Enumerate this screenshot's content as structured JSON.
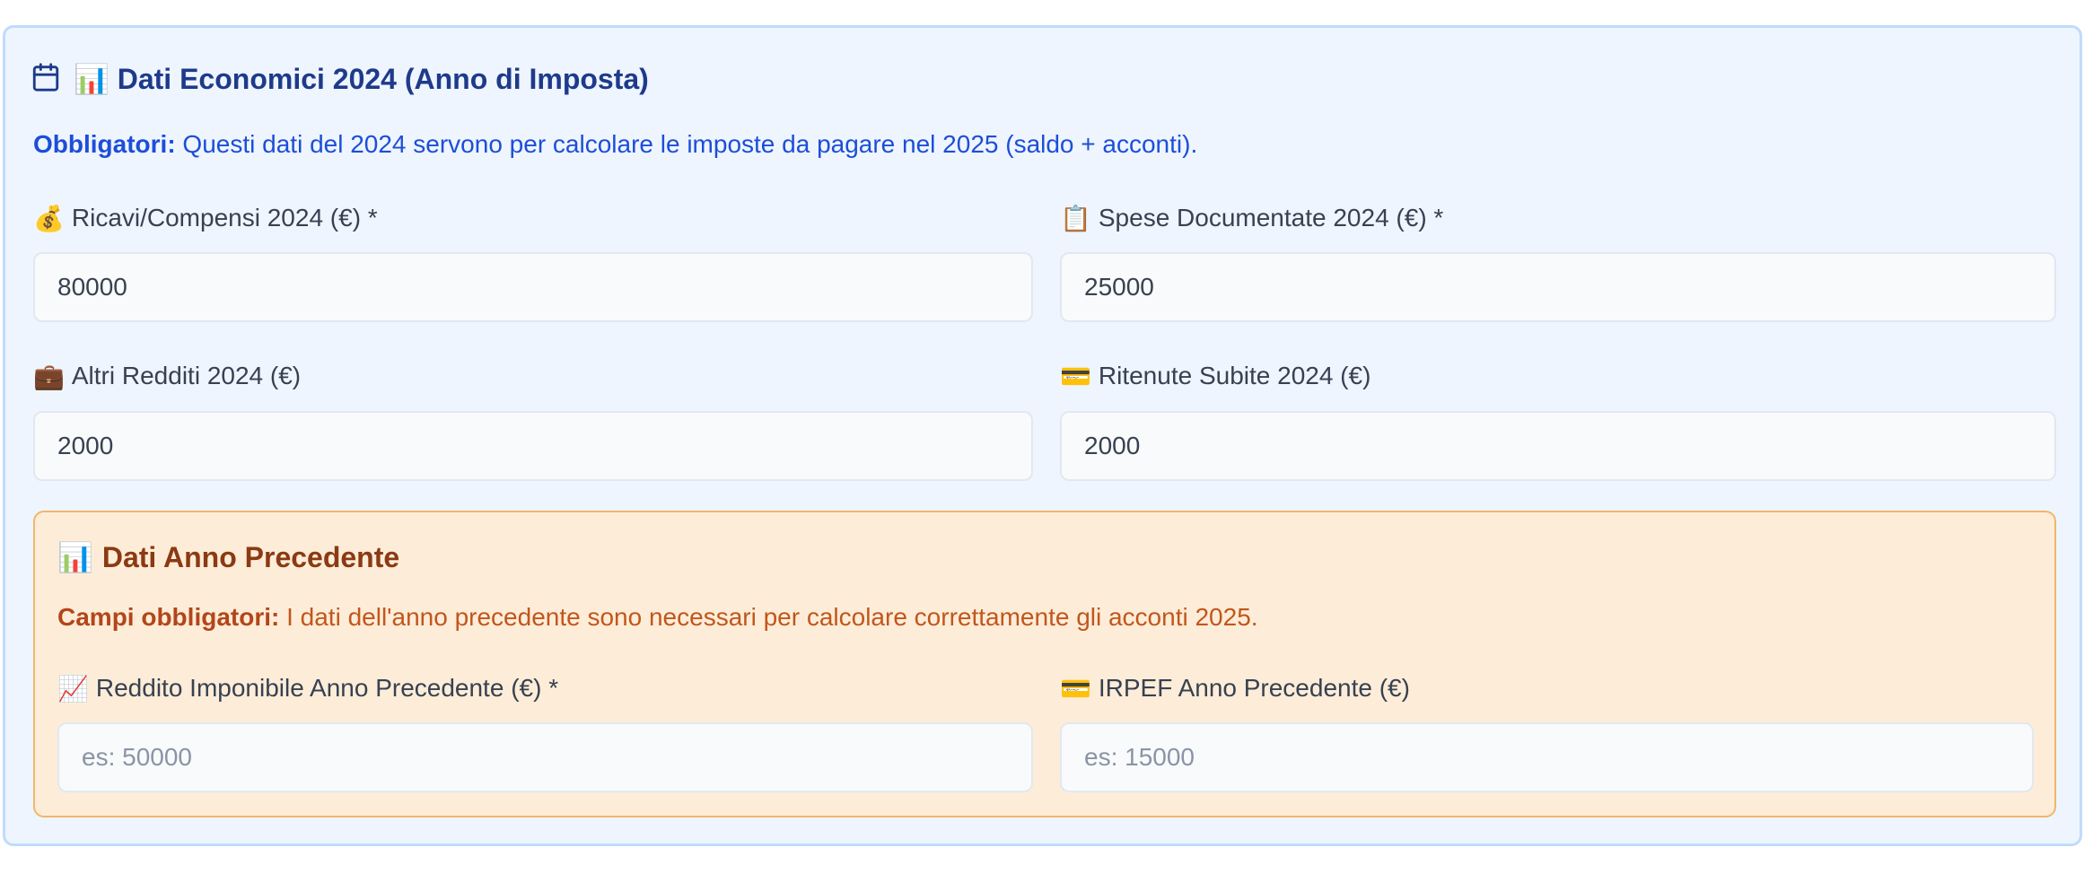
{
  "section": {
    "title": "📊 Dati Economici 2024 (Anno di Imposta)",
    "notice_bold": "Obbligatori:",
    "notice_text": " Questi dati del 2024 servono per calcolare le imposte da pagare nel 2025 (saldo + acconti)."
  },
  "fields": {
    "ricavi": {
      "label": "Ricavi/Compensi 2024 (€) *",
      "value": "80000",
      "icon": "money-bag-icon"
    },
    "spese": {
      "label": "Spese Documentate 2024 (€) *",
      "value": "25000",
      "icon": "clipboard-icon"
    },
    "altri": {
      "label": "Altri Redditi 2024 (€)",
      "value": "2000",
      "icon": "briefcase-icon"
    },
    "ritenute": {
      "label": "Ritenute Subite 2024 (€)",
      "value": "2000",
      "icon": "credit-card-icon"
    }
  },
  "previous": {
    "title": "Dati Anno Precedente",
    "notice_bold": "Campi obbligatori:",
    "notice_text": " I dati dell'anno precedente sono necessari per calcolare correttamente gli acconti 2025.",
    "reddito": {
      "label": "Reddito Imponibile Anno Precedente (€) *",
      "placeholder": "es: 50000",
      "value": "",
      "icon": "chart-increasing-icon"
    },
    "irpef": {
      "label": "IRPEF Anno Precedente (€)",
      "placeholder": "es: 15000",
      "value": "",
      "icon": "credit-card-icon"
    }
  },
  "colors": {
    "card_bg": "#eef5fe",
    "card_border": "#bfdbfe",
    "title": "#1e3a8a",
    "notice": "#1d4ed8",
    "prev_bg": "#fdedd8",
    "prev_border": "#f0b76a",
    "prev_title": "#8b3a14"
  }
}
